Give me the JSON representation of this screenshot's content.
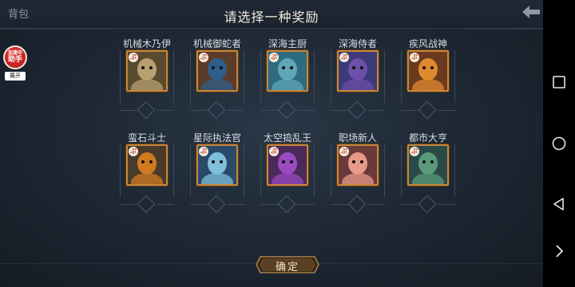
{
  "header": {
    "bag_label": "背包",
    "title": "请选择一种奖励"
  },
  "assistant": {
    "badge_top": "加速中",
    "badge_main": "助手",
    "expand_label": "展开"
  },
  "rewards": [
    {
      "name": "机械木乃伊",
      "tag": "ぷ",
      "bg": "#5a4a2e",
      "fg": "#b8a070"
    },
    {
      "name": "机械御蛇者",
      "tag": "ぷ",
      "bg": "#5b3c2a",
      "fg": "#2f5d8a"
    },
    {
      "name": "深海主厨",
      "tag": "ぷ",
      "bg": "#2e6b80",
      "fg": "#5fa5b8"
    },
    {
      "name": "深海侍者",
      "tag": "ぷ",
      "bg": "#3c3a78",
      "fg": "#6b4fa8"
    },
    {
      "name": "疾风战神",
      "tag": "ぷ",
      "bg": "#6b3a1e",
      "fg": "#e08a30"
    },
    {
      "name": "蛮石斗士",
      "tag": "ぷ",
      "bg": "#4a3a2a",
      "fg": "#d07a20"
    },
    {
      "name": "星际执法官",
      "tag": "ぷ",
      "bg": "#2a4a6a",
      "fg": "#7fc0d8"
    },
    {
      "name": "太空捣乱王",
      "tag": "ぷ",
      "bg": "#4a2a5a",
      "fg": "#9a4ac0"
    },
    {
      "name": "职场新人",
      "tag": "ぷ",
      "bg": "#6a3a3a",
      "fg": "#e89a8a"
    },
    {
      "name": "都市大亨",
      "tag": "ぷ",
      "bg": "#2a4a4a",
      "fg": "#5a9a7a"
    }
  ],
  "confirm_label": "确定",
  "colors": {
    "frame_gold": "#c8873a",
    "background": "#1d2632"
  },
  "system_nav": [
    "square-icon",
    "circle-icon",
    "triangle-back-icon",
    "chevron-right-icon"
  ]
}
